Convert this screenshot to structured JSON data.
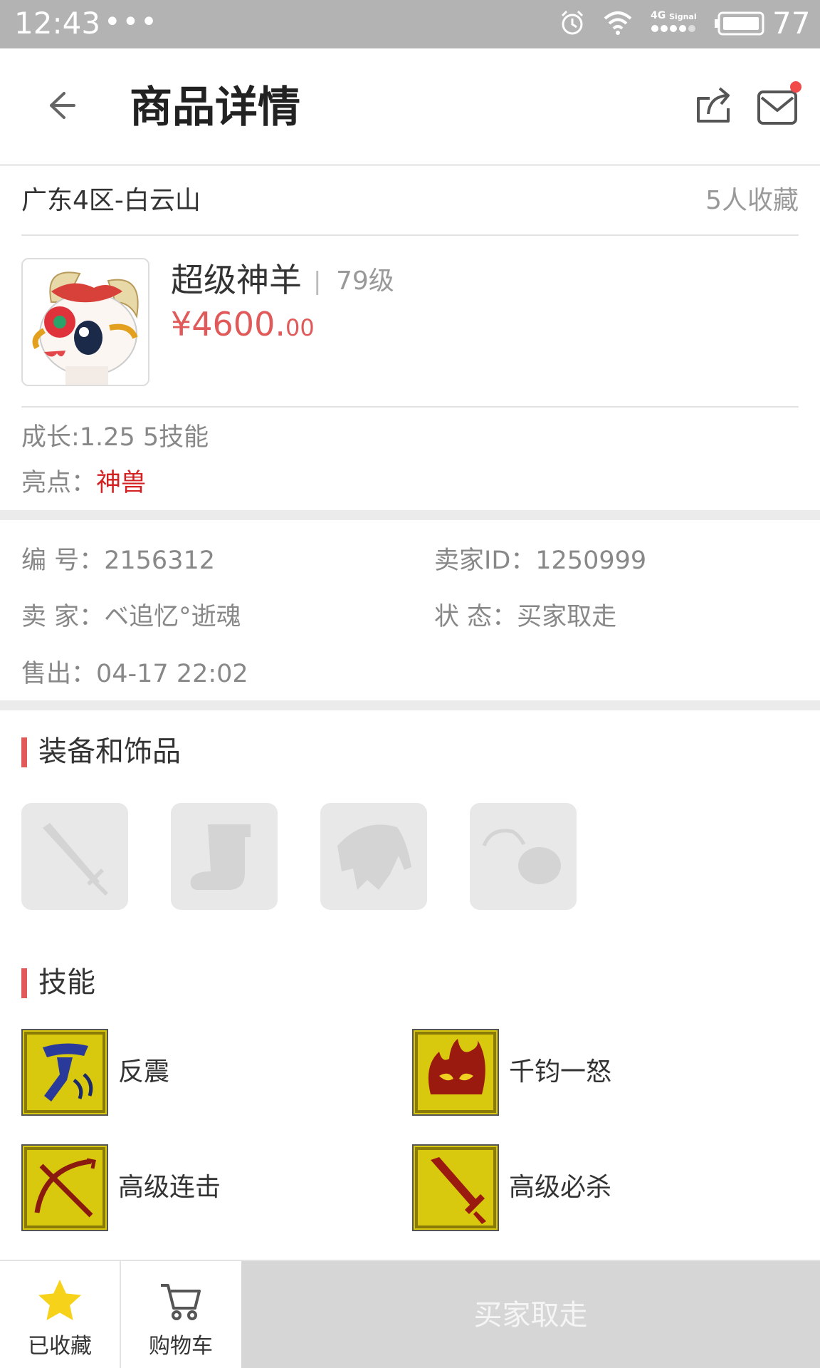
{
  "status_bar": {
    "time": "12:43",
    "dots": "•••",
    "network": "4G",
    "signal_label": "Signal",
    "battery": "77"
  },
  "header": {
    "title": "商品详情"
  },
  "server": {
    "name": "广东4区-白云山",
    "favorites": "5人收藏"
  },
  "product": {
    "name": "超级神羊",
    "separator": "|",
    "level": "79级",
    "price_main": "¥4600.",
    "price_decimal": "00"
  },
  "attributes": {
    "growth": "成长:1.25 5技能",
    "highlight_label": "亮点：",
    "highlight_value": "神兽"
  },
  "info": {
    "id": "编  号：2156312",
    "seller_id": "卖家ID：1250999",
    "seller": "卖  家：ベ追忆°逝魂",
    "status": "状  态：买家取走",
    "sold": "售出：04-17 22:02"
  },
  "sections": {
    "equipment": "装备和饰品",
    "skills": "技能"
  },
  "equipment_slots": [
    "weapon-slot",
    "boots-slot",
    "armor-slot",
    "accessory-slot"
  ],
  "skills": [
    {
      "name": "反震"
    },
    {
      "name": "千钧一怒"
    },
    {
      "name": "高级连击"
    },
    {
      "name": "高级必杀"
    }
  ],
  "bottom_bar": {
    "favorited_label": "已收藏",
    "cart_label": "购物车",
    "buy_label": "买家取走"
  },
  "colors": {
    "price": "#e05a5a",
    "highlight": "#d32020",
    "accent": "#e05a5a",
    "star": "#f7d21a",
    "disabled_button": "#d6d6d6"
  }
}
